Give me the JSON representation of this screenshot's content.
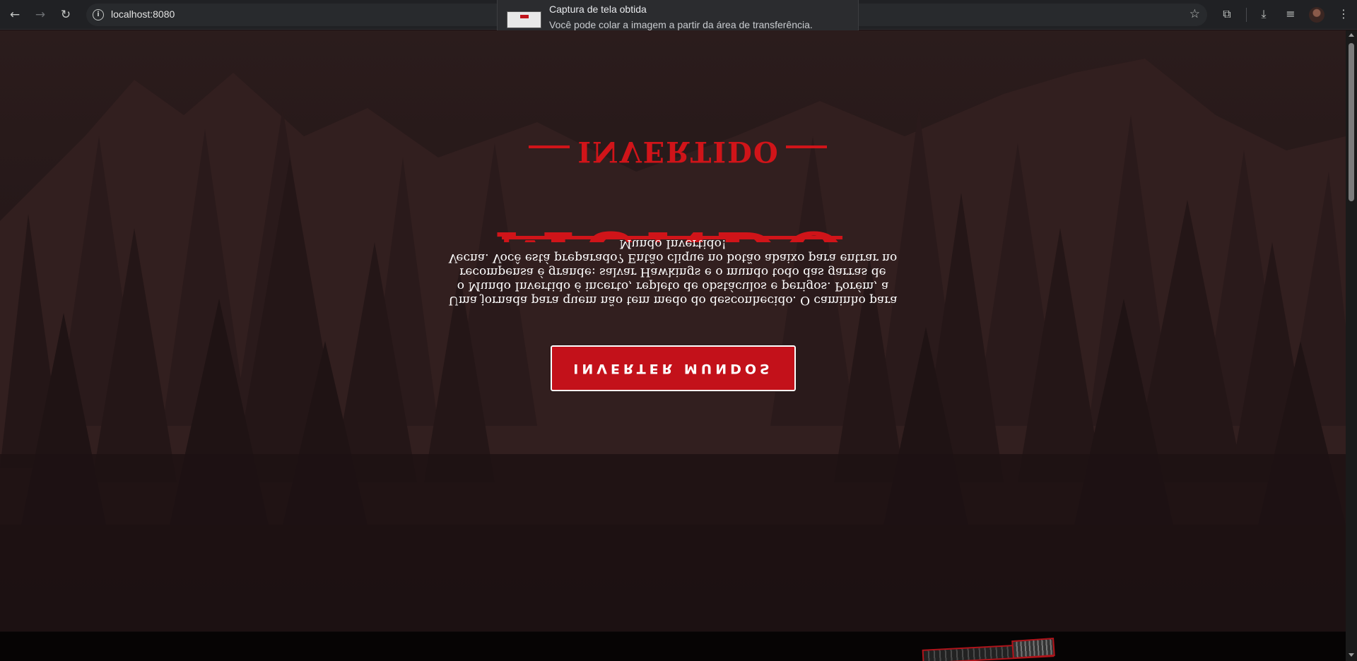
{
  "browser": {
    "url": "localhost:8080",
    "icons": {
      "back": "arrow-left-icon",
      "forward": "arrow-right-icon",
      "reload": "reload-icon",
      "site_info": "info-icon",
      "bookmark": "star-icon",
      "extensions": "puzzle-icon",
      "downloads": "download-icon",
      "media": "playlist-icon",
      "profile": "avatar",
      "menu": "kebab-icon"
    }
  },
  "toast": {
    "title": "Captura de tela obtida",
    "message": "Você pode colar a imagem a partir da área de transferência."
  },
  "hero": {
    "logo_top": "INVERTIDO",
    "logo_main": "MUNDO",
    "intro": "Uma jornada para quem não tem medo do desconhecido. O caminho para o Mundo Invertido é incerto, repleto de obstáculos e perigos. Porém, a recompensa é grande: salvar Hawkings e o mundo todo das garras de Vecna. Você está preparado? Então clique no botão abaixo para entrar no Mundo Invertido!",
    "button_label": "INVERTER MUNDOS"
  },
  "colors": {
    "accent": "#c3111a",
    "logo": "#d01419",
    "background": "#241718",
    "footer": "#060404"
  }
}
